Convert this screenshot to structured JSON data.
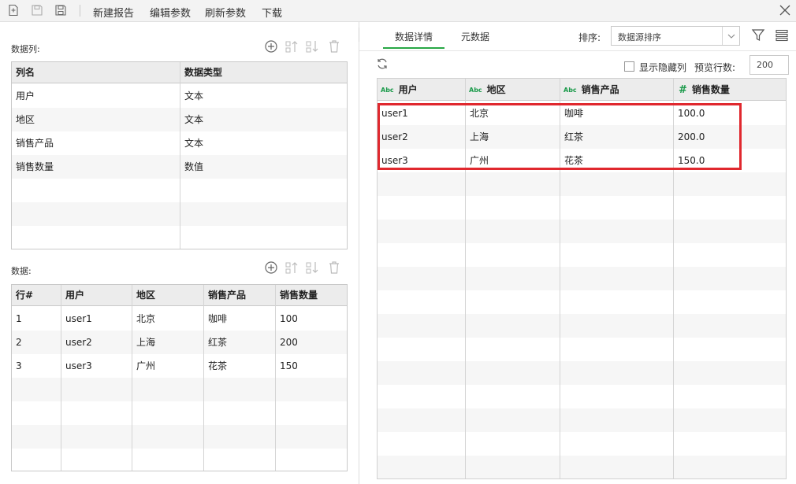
{
  "toolbar": {
    "new_report": "新建报告",
    "edit_params": "编辑参数",
    "refresh_params": "刷新参数",
    "download": "下载"
  },
  "columns_section": {
    "label": "数据列:",
    "headers": [
      "列名",
      "数据类型"
    ],
    "rows": [
      {
        "name": "用户",
        "type": "文本"
      },
      {
        "name": "地区",
        "type": "文本"
      },
      {
        "name": "销售产品",
        "type": "文本"
      },
      {
        "name": "销售数量",
        "type": "数值"
      }
    ]
  },
  "data_section": {
    "label": "数据:",
    "headers": [
      "行#",
      "用户",
      "地区",
      "销售产品",
      "销售数量"
    ],
    "rows": [
      [
        "1",
        "user1",
        "北京",
        "咖啡",
        "100"
      ],
      [
        "2",
        "user2",
        "上海",
        "红茶",
        "200"
      ],
      [
        "3",
        "user3",
        "广州",
        "花茶",
        "150"
      ]
    ]
  },
  "right": {
    "tabs": [
      "数据详情",
      "元数据"
    ],
    "active_tab": 0,
    "sort_label": "排序:",
    "sort_value": "数据源排序",
    "show_hidden_label": "显示隐藏列",
    "preview_rows_label": "预览行数:",
    "preview_rows_value": "200",
    "detail_headers": [
      {
        "type": "Abc",
        "label": "用户"
      },
      {
        "type": "Abc",
        "label": "地区"
      },
      {
        "type": "Abc",
        "label": "销售产品"
      },
      {
        "type": "#",
        "label": "销售数量"
      }
    ],
    "detail_rows": [
      [
        "user1",
        "北京",
        "咖啡",
        "100.0"
      ],
      [
        "user2",
        "上海",
        "红茶",
        "200.0"
      ],
      [
        "user3",
        "广州",
        "花茶",
        "150.0"
      ]
    ]
  },
  "colors": {
    "accent_green": "#28a745",
    "highlight_red": "#e0282e"
  }
}
